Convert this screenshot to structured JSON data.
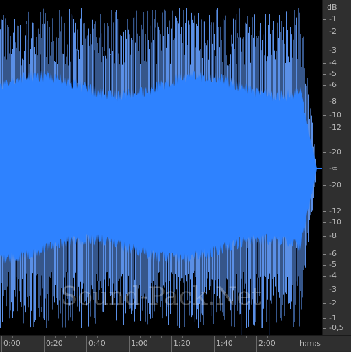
{
  "colors": {
    "background": "#000000",
    "waveform_fill": "#2e82ff",
    "waveform_peaks": "#5a8fe6",
    "ruler_background": "#2f2f2f",
    "ruler_text": "#b9b9b9"
  },
  "watermark": "Sound-Pack.Net",
  "db_scale": {
    "unit_label": "dB",
    "labels": [
      "-1",
      "-2",
      "-3",
      "-4",
      "-5",
      "-6",
      "-8",
      "-10",
      "-12",
      "-20",
      "-∞",
      "-20",
      "-12",
      "-10",
      "-8",
      "-6",
      "-5",
      "-4",
      "-3",
      "-2",
      "-1",
      "-0,5"
    ]
  },
  "time_scale": {
    "labels": [
      "0:00",
      "0:20",
      "0:40",
      "1:00",
      "1:20",
      "1:40",
      "2:00"
    ],
    "unit_label": "h:m:s"
  }
}
